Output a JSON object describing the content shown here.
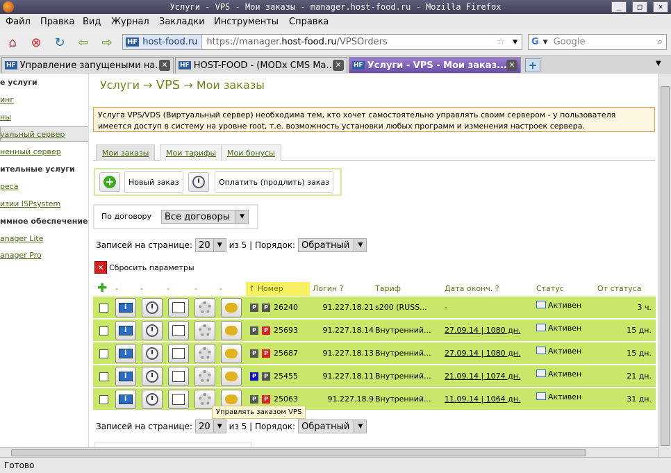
{
  "window": {
    "title": "Услуги - VPS - Мои заказы - manager.host-food.ru - Mozilla Firefox"
  },
  "menu": [
    "Файл",
    "Правка",
    "Вид",
    "Журнал",
    "Закладки",
    "Инструменты",
    "Справка"
  ],
  "urlbar": {
    "site": "host-food.ru",
    "site_badge": "HF",
    "url_prefix": "https://manager.",
    "url_domain": "host-food.ru",
    "url_path": "/VPSOrders"
  },
  "search": {
    "placeholder": "Google"
  },
  "tabs": [
    {
      "label": "Управление запущеными на..."
    },
    {
      "label": "HOST-FOOD - (MODx CMS Ma..."
    },
    {
      "label": "Услуги - VPS - Мои заказ..."
    }
  ],
  "sidebar": [
    "е услуги",
    "инг",
    "ны",
    "уальный сервер",
    "ненный сервер",
    "ительные услуги",
    "реса",
    "изии ISPsystem",
    "ммное обеспечение",
    "anager Lite",
    "anager Pro"
  ],
  "breadcrumb": {
    "a": "Услуги",
    "b": "VPS",
    "c": "Мои заказы",
    "sep": "→"
  },
  "info": "Услуга VPS/VDS (Виртуальный сервер) необходима тем, кто хочет самостоятельно управлять своим сервером - у пользователя имеется доступ в систему на уровне root, т.е. возможность установки любых программ и изменения настроек сервера.",
  "subtabs": [
    "Мои заказы",
    "Мои тарифы",
    "Мои бонусы"
  ],
  "actions": {
    "new": "Новый заказ",
    "pay": "Оплатить (продлить) заказ"
  },
  "filter": {
    "label": "По договору",
    "value": "Все договоры"
  },
  "pager": {
    "label": "Записей на странице:",
    "per_page": "20",
    "of": "из 5 | Порядок:",
    "order": "Обратный"
  },
  "reset": "Сбросить параметры",
  "columns": {
    "dash": "-",
    "number": "Номер",
    "login": "Логин ?",
    "tariff": "Тариф",
    "date": "Дата оконч. ?",
    "status": "Статус",
    "since": "От статуса"
  },
  "rows": [
    {
      "num": "26240",
      "login": "91.227.18.21",
      "tariff": "s200 (RUSS...",
      "date": "-",
      "status": "Активен",
      "since": "3 ч."
    },
    {
      "num": "25693",
      "login": "91.227.18.14",
      "tariff": "Внутренний...",
      "date": "27.09.14 | 1080 дн.",
      "status": "Активен",
      "since": "15 дн."
    },
    {
      "num": "25687",
      "login": "91.227.18.13",
      "tariff": "Внутренний...",
      "date": "27.09.14 | 1080 дн.",
      "status": "Активен",
      "since": "15 дн."
    },
    {
      "num": "25455",
      "login": "91.227.18.11",
      "tariff": "Внутренний...",
      "date": "21.09.14 | 1074 дн.",
      "status": "Активен",
      "since": "21 дн."
    },
    {
      "num": "25063",
      "login": "91.227.18.9",
      "tariff": "Внутренний...",
      "date": "11.09.14 | 1064 дн.",
      "status": "Активен",
      "since": "31 дн."
    }
  ],
  "tooltip": "Управлять заказом VPS",
  "statusbar": "Готово",
  "colors": {
    "row_bg": "#c9e86a",
    "accent": "#6a8a1a"
  }
}
